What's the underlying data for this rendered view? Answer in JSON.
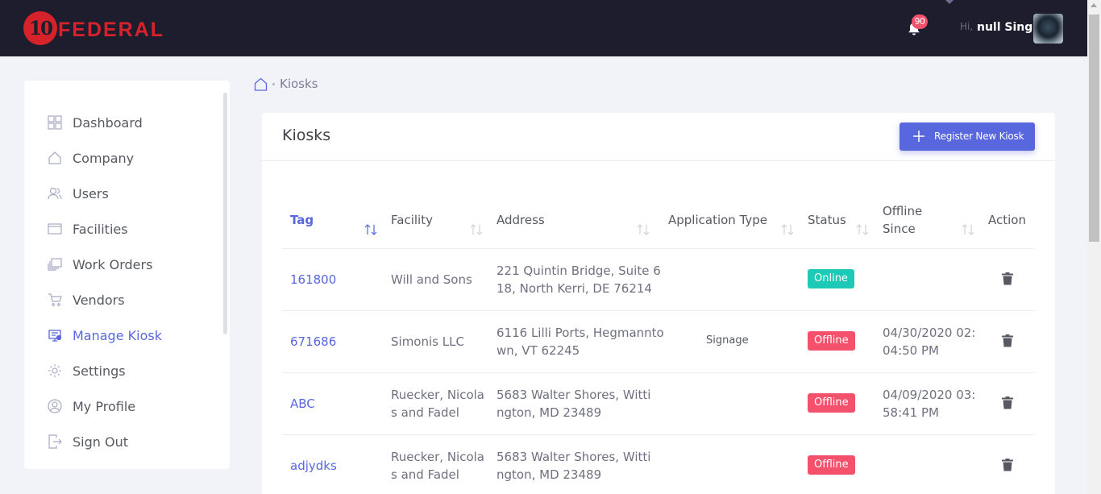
{
  "header": {
    "logo_number": "10",
    "logo_text": "FEDERAL",
    "notification_count": "90",
    "greeting": "Hi,",
    "user_name": "null Singh"
  },
  "sidebar": {
    "items": [
      {
        "label": "Dashboard",
        "icon": "dashboard-icon"
      },
      {
        "label": "Company",
        "icon": "home-icon"
      },
      {
        "label": "Users",
        "icon": "users-icon"
      },
      {
        "label": "Facilities",
        "icon": "facilities-icon"
      },
      {
        "label": "Work Orders",
        "icon": "work-orders-icon"
      },
      {
        "label": "Vendors",
        "icon": "cart-icon"
      },
      {
        "label": "Manage Kiosk",
        "icon": "kiosk-icon",
        "active": true
      },
      {
        "label": "Settings",
        "icon": "gear-icon"
      },
      {
        "label": "My Profile",
        "icon": "profile-icon"
      },
      {
        "label": "Sign Out",
        "icon": "sign-out-icon"
      }
    ]
  },
  "breadcrumb": {
    "current": "Kiosks"
  },
  "card": {
    "title": "Kiosks",
    "register_button": "Register New Kiosk"
  },
  "table": {
    "columns": {
      "tag": "Tag",
      "facility": "Facility",
      "address": "Address",
      "application_type": "Application Type",
      "status": "Status",
      "offline_since_1": "Offline",
      "offline_since_2": "Since",
      "action": "Action"
    },
    "rows": [
      {
        "tag": "161800",
        "facility_1": "Will and Sons",
        "facility_2": "",
        "address_1": "221 Quintin Bridge, Suite 6",
        "address_2": "18, North Kerri, DE 76214",
        "application_type": "",
        "status": "Online",
        "offline_1": "",
        "offline_2": ""
      },
      {
        "tag": "671686",
        "facility_1": "Simonis LLC",
        "facility_2": "",
        "address_1": "6116 Lilli Ports, Hegmannto",
        "address_2": "wn, VT 62245",
        "application_type": "Signage",
        "status": "Offline",
        "offline_1": "04/30/2020 02:",
        "offline_2": "04:50 PM"
      },
      {
        "tag": "ABC",
        "facility_1": "Ruecker, Nicola",
        "facility_2": "s and Fadel",
        "address_1": "5683 Walter Shores, Witti",
        "address_2": "ngton, MD 23489",
        "application_type": "",
        "status": "Offline",
        "offline_1": "04/09/2020 03:",
        "offline_2": "58:41 PM"
      },
      {
        "tag": "adjydks",
        "facility_1": "Ruecker, Nicola",
        "facility_2": "s and Fadel",
        "address_1": "5683 Walter Shores, Witti",
        "address_2": "ngton, MD 23489",
        "application_type": "",
        "status": "Offline",
        "offline_1": "",
        "offline_2": ""
      }
    ]
  },
  "colors": {
    "topbar": "#1e1d2d",
    "brand_red": "#d6222b",
    "accent": "#5867dd",
    "online": "#1dc9b7",
    "offline": "#f4516c"
  }
}
